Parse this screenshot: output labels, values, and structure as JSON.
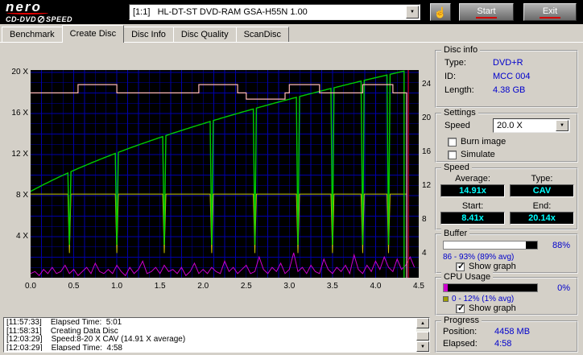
{
  "header": {
    "logo_main": "nero",
    "logo_sub_left": "CD-DVD",
    "logo_sub_right": "SPEED",
    "drive_select": "[1:1]   HL-DT-ST DVD-RAM GSA-H55N 1.00",
    "start_button": "Start",
    "exit_button": "Exit"
  },
  "tabs": [
    {
      "label": "Benchmark",
      "active": false
    },
    {
      "label": "Create Disc",
      "active": true
    },
    {
      "label": "Disc Info",
      "active": false
    },
    {
      "label": "Disc Quality",
      "active": false
    },
    {
      "label": "ScanDisc",
      "active": false
    }
  ],
  "disc_info": {
    "title": "Disc info",
    "rows": [
      {
        "label": "Type:",
        "value": "DVD+R"
      },
      {
        "label": "ID:",
        "value": "MCC 004"
      },
      {
        "label": "Length:",
        "value": "4.38 GB"
      }
    ]
  },
  "settings": {
    "title": "Settings",
    "speed_label": "Speed",
    "speed_value": "20.0 X",
    "checkboxes": [
      {
        "label": "Burn image",
        "checked": false,
        "glyph": ""
      },
      {
        "label": "Simulate",
        "checked": false,
        "glyph": ""
      }
    ]
  },
  "speed_panel": {
    "title": "Speed",
    "average_label": "Average:",
    "type_label": "Type:",
    "average_value": "14.91x",
    "type_value": "CAV",
    "start_label": "Start:",
    "end_label": "End:",
    "start_value": "8.41x",
    "end_value": "20.14x"
  },
  "buffer_panel": {
    "title": "Buffer",
    "percent": "88%",
    "fill_percent": 88,
    "fill_color": "#ffffff",
    "range": "86 - 93% (89% avg)",
    "show_graph": "Show graph",
    "show_graph_checked": true,
    "show_graph_glyph": "✓"
  },
  "cpu_panel": {
    "title": "CPU Usage",
    "percent": "0%",
    "fill_percent": 4,
    "fill_color": "#cc00cc",
    "range": "0 - 12% (1% avg)",
    "swatch_color": "#a0a000",
    "show_graph": "Show graph",
    "show_graph_checked": true,
    "show_graph_glyph": "✓"
  },
  "progress_panel": {
    "title": "Progress",
    "position_label": "Position:",
    "position_value": "4458 MB",
    "elapsed_label": "Elapsed:",
    "elapsed_value": "4:58"
  },
  "log": {
    "lines": [
      "[11:57:33]    Elapsed Time:  5:01",
      "[11:58:31]    Creating Data Disc",
      "[12:03:29]    Speed:8-20 X CAV (14.91 X average)",
      "[12:03:29]    Elapsed Time:  4:58"
    ]
  },
  "chart_data": {
    "type": "line",
    "title": "",
    "plot_bg": "#000000",
    "grid": {
      "color": "#0000aa",
      "x_step": 0.125,
      "y_step": 1
    },
    "x_axis": {
      "min": 0,
      "max": 4.5,
      "ticks": [
        "0.0",
        "0.5",
        "1.0",
        "1.5",
        "2.0",
        "2.5",
        "3.0",
        "3.5",
        "4.0",
        "4.5"
      ]
    },
    "y_axis_left": {
      "min": 0,
      "max": 20.24,
      "ticks": [
        {
          "v": 20,
          "label": "20 X"
        },
        {
          "v": 16,
          "label": "16 X"
        },
        {
          "v": 12,
          "label": "12 X"
        },
        {
          "v": 8,
          "label": "8 X"
        },
        {
          "v": 4,
          "label": "4 X"
        }
      ]
    },
    "y_axis_right": {
      "ticks": [
        {
          "v": 24,
          "label": "24"
        },
        {
          "v": 20,
          "label": "20"
        },
        {
          "v": 16,
          "label": "16"
        },
        {
          "v": 12,
          "label": "12"
        },
        {
          "v": 8,
          "label": "8"
        },
        {
          "v": 4,
          "label": "4"
        }
      ]
    },
    "position_marker": {
      "x": 4.38,
      "color": "#cc0000"
    },
    "series": [
      {
        "name": "write-speed",
        "color": "#00cc00",
        "curve": "cav",
        "start_speed": 8.41,
        "end_speed": 20.14,
        "end_x": 4.33,
        "dips": [
          0.45,
          1.0,
          1.55,
          2.1,
          2.6,
          3.1,
          3.5,
          3.85,
          4.15
        ],
        "dip_value": 3.2
      },
      {
        "name": "reference-speed",
        "color": "#c8c800",
        "level": 8.15,
        "end_x": 4.36,
        "dips": [
          0.45,
          1.0,
          1.55,
          2.1,
          2.6,
          3.1,
          3.5,
          3.85,
          4.15
        ],
        "dip_value": 2.4
      },
      {
        "name": "buffer-level",
        "color": "#ffb8b8",
        "unit": "percent",
        "end_x": 4.36,
        "steps": [
          [
            0,
            89
          ],
          [
            0.55,
            93
          ],
          [
            1.0,
            89
          ],
          [
            1.95,
            93
          ],
          [
            2.4,
            89
          ],
          [
            2.5,
            86
          ],
          [
            2.95,
            89
          ],
          [
            3.0,
            93
          ],
          [
            3.35,
            89
          ],
          [
            3.85,
            93
          ],
          [
            4.2,
            89
          ]
        ]
      },
      {
        "name": "cpu-usage",
        "color": "#cc00cc",
        "unit": "percent",
        "x_step": 0.05,
        "values": [
          2,
          3,
          1,
          4,
          2,
          5,
          2,
          3,
          6,
          2,
          4,
          1,
          3,
          5,
          2,
          7,
          3,
          2,
          4,
          2,
          6,
          3,
          1,
          5,
          2,
          4,
          8,
          2,
          3,
          5,
          2,
          6,
          3,
          4,
          2,
          5,
          1,
          3,
          7,
          2,
          4,
          2,
          5,
          3,
          2,
          8,
          3,
          5,
          2,
          4,
          6,
          2,
          3,
          10,
          4,
          2,
          5,
          3,
          7,
          2,
          4,
          12,
          3,
          5,
          2,
          6,
          3,
          2,
          9,
          4,
          2,
          5,
          3,
          6,
          2,
          11,
          4,
          2,
          6,
          3,
          8,
          4,
          10,
          5,
          3,
          9,
          4,
          6,
          10,
          5
        ]
      }
    ]
  }
}
